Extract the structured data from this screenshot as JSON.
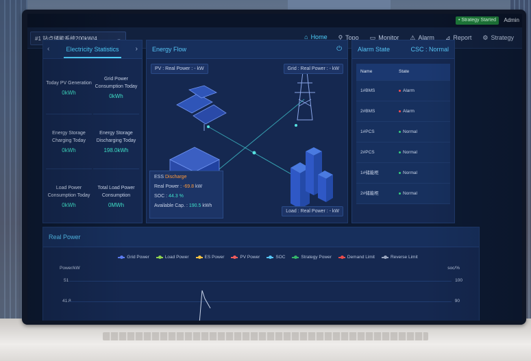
{
  "top": {
    "strategy_status": "• Strategy Started",
    "user": "Admin"
  },
  "site_selector": {
    "value": "#1 站点储能系统200kW/4...",
    "chevron": "chevron-down-icon"
  },
  "nav": {
    "items": [
      {
        "label": "Home",
        "icon": "home-icon",
        "active": true
      },
      {
        "label": "Topo",
        "icon": "topology-icon"
      },
      {
        "label": "Monitor",
        "icon": "monitor-icon"
      },
      {
        "label": "Alarm",
        "icon": "alarm-icon"
      },
      {
        "label": "Report",
        "icon": "report-icon"
      },
      {
        "label": "Strategy",
        "icon": "gear-icon"
      }
    ]
  },
  "electricity": {
    "title": "Electricity Statistics",
    "stats": [
      {
        "label": "Today PV Generation",
        "value": "0kWh"
      },
      {
        "label": "Grid Power Consumption Today",
        "value": "0kWh"
      },
      {
        "label": "Energy Storage Charging Today",
        "value": "0kWh"
      },
      {
        "label": "Energy Storage Discharging Today",
        "value": "198.0kWh"
      },
      {
        "label": "Load Power Consumption Today",
        "value": "0kWh"
      },
      {
        "label": "Total Load Power Consumption",
        "value": "0MWh"
      }
    ]
  },
  "energy_flow": {
    "title": "Energy Flow",
    "pv_tag": "PV  :  Real Power :  - kW",
    "grid_tag": "Grid  :  Real Power :  - kW",
    "load_tag": "Load  :  Real Power :  - kW",
    "ess": {
      "prefix": "ESS ",
      "status": "Discharge",
      "real_power_label": "Real Power : ",
      "real_power_value": "-69.8",
      "real_power_unit": " kW",
      "soc_label": "SOC : ",
      "soc_value": "44.3 %",
      "cap_label": "Available Cap. : ",
      "cap_value": "190.5",
      "cap_unit": " kWh"
    }
  },
  "alarm_state": {
    "title": "Alarm State",
    "csc": "CSC : Normal",
    "columns": [
      "Name",
      "State"
    ],
    "rows": [
      {
        "name": "1#BMS",
        "state": "Alarm",
        "color": "#ff4d4f"
      },
      {
        "name": "2#BMS",
        "state": "Alarm",
        "color": "#ff4d4f"
      },
      {
        "name": "1#PCS",
        "state": "Normal",
        "color": "#35d07f"
      },
      {
        "name": "2#PCS",
        "state": "Normal",
        "color": "#35d07f"
      },
      {
        "name": "1#储能柜",
        "state": "Normal",
        "color": "#35d07f"
      },
      {
        "name": "2#储能柜",
        "state": "Normal",
        "color": "#35d07f"
      }
    ]
  },
  "real_power": {
    "title": "Real Power",
    "legend": [
      {
        "name": "Grid Power",
        "color": "#5b7cf0"
      },
      {
        "name": "Load Power",
        "color": "#8fd14f"
      },
      {
        "name": "ES Power",
        "color": "#f5c242"
      },
      {
        "name": "PV Power",
        "color": "#f25c5c"
      },
      {
        "name": "SOC",
        "color": "#56c4f5"
      },
      {
        "name": "Strategy Power",
        "color": "#35b56a"
      },
      {
        "name": "Demand Limit",
        "color": "#e84b4b"
      },
      {
        "name": "Reverse Limit",
        "color": "#9aa6bf"
      }
    ],
    "y_left_label": "Power/kW",
    "y_right_label": "soc/%",
    "y_left_ticks": [
      "51",
      "41.8"
    ],
    "y_right_ticks": [
      "100",
      "90"
    ]
  }
}
